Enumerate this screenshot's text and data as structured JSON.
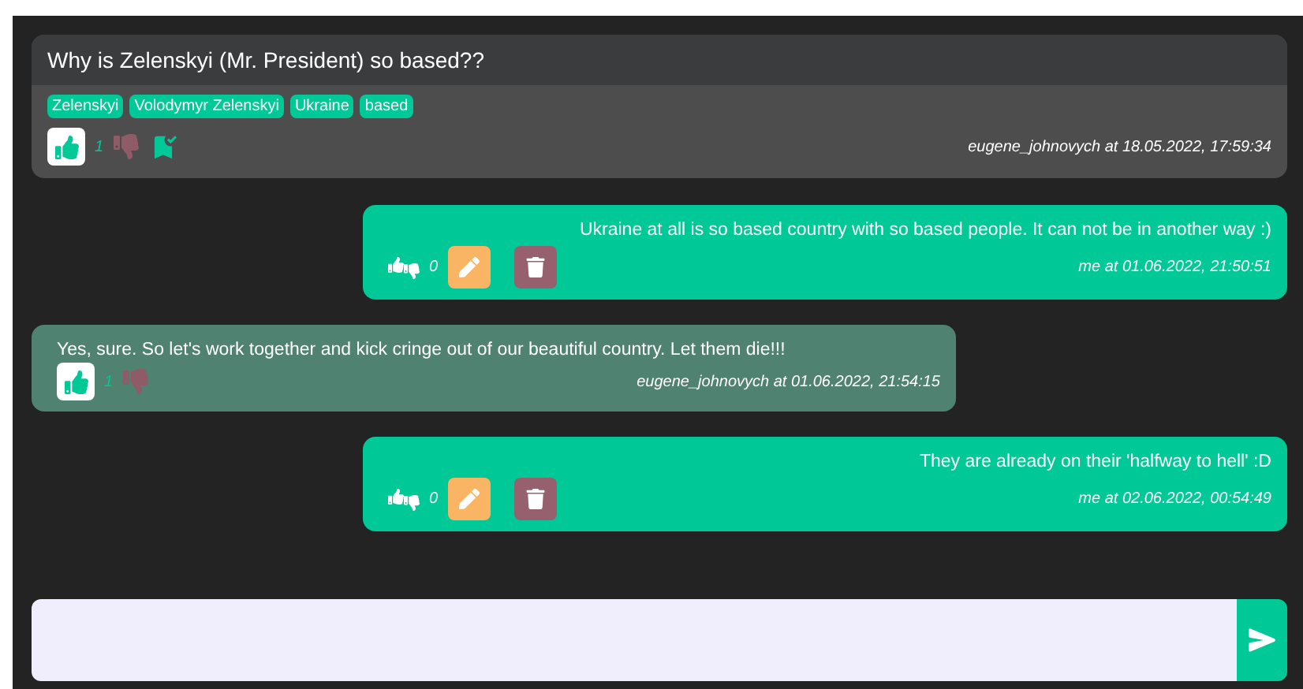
{
  "post": {
    "title": "Why is Zelenskyi (Mr. President) so based??",
    "tags": [
      "Zelenskyi",
      "Volodymyr Zelenskyi",
      "Ukraine",
      "based"
    ],
    "liked": true,
    "likes": "1",
    "bookmarked": true,
    "meta": "eugene_johnovych at 18.05.2022, 17:59:34"
  },
  "messages": [
    {
      "kind": "own",
      "text": "Ukraine at all is so based country with so based people. It can not be in another way :)",
      "likes": "0",
      "meta": "me at 01.06.2022, 21:50:51"
    },
    {
      "kind": "other",
      "text": "Yes, sure. So let's work together and kick cringe out of our beautiful country. Let them die!!!",
      "likes": "1",
      "liked": true,
      "meta": "eugene_johnovych at 01.06.2022, 21:54:15"
    },
    {
      "kind": "own",
      "text": "They are already on their 'halfway to hell' :D",
      "likes": "0",
      "meta": "me at 02.06.2022, 00:54:49"
    }
  ]
}
